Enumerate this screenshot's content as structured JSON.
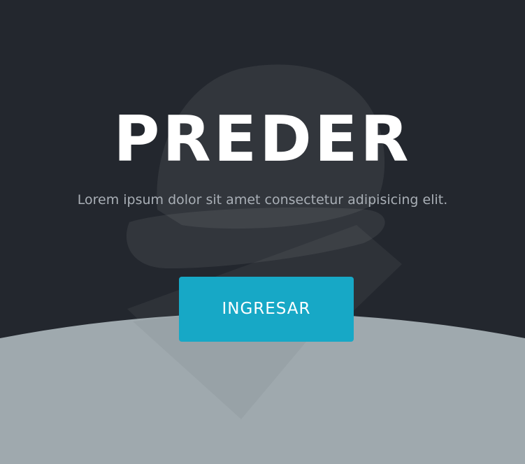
{
  "hero": {
    "title": "PREDER",
    "subtitle": "Lorem ipsum dolor sit amet consectetur adipisicing elit.",
    "cta_label": "INGRESAR",
    "background_icon": "hard-hat-icon"
  },
  "colors": {
    "background_dark": "#23272e",
    "wave_gray": "#9fa9ae",
    "accent": "#17a8c6",
    "title": "#ffffff",
    "subtitle": "#a9afb6"
  }
}
